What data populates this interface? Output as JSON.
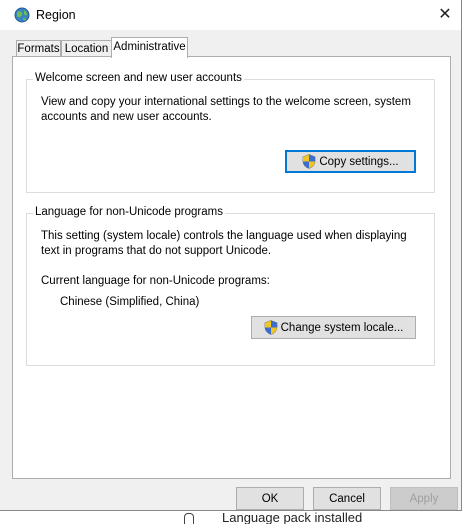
{
  "window": {
    "title": "Region",
    "close_glyph": "✕"
  },
  "tabs": [
    {
      "label": "Formats",
      "active": false
    },
    {
      "label": "Location",
      "active": false
    },
    {
      "label": "Administrative",
      "active": true
    }
  ],
  "welcome_group": {
    "title": "Welcome screen and new user accounts",
    "description_lines": [
      "View and copy your international settings to the welcome screen, system",
      "accounts and new user accounts."
    ],
    "button_label": "Copy settings..."
  },
  "unicode_group": {
    "title": "Language for non-Unicode programs",
    "description_lines": [
      "This setting (system locale) controls the language used when displaying",
      "text in programs that do not support Unicode."
    ],
    "current_label": "Current language for non-Unicode programs:",
    "current_value": "Chinese (Simplified, China)",
    "button_label": "Change system locale..."
  },
  "footer": {
    "ok_label": "OK",
    "cancel_label": "Cancel",
    "apply_label": "Apply"
  },
  "background": {
    "bottom_text": "Language pack installed",
    "left_char": "g"
  },
  "icons": {
    "title": "globe-icon",
    "uac": "uac-shield-icon"
  },
  "colors": {
    "accent": "#0078d7",
    "dialog_bg": "#f0f0f0",
    "disabled_text": "#a0a0a0"
  }
}
